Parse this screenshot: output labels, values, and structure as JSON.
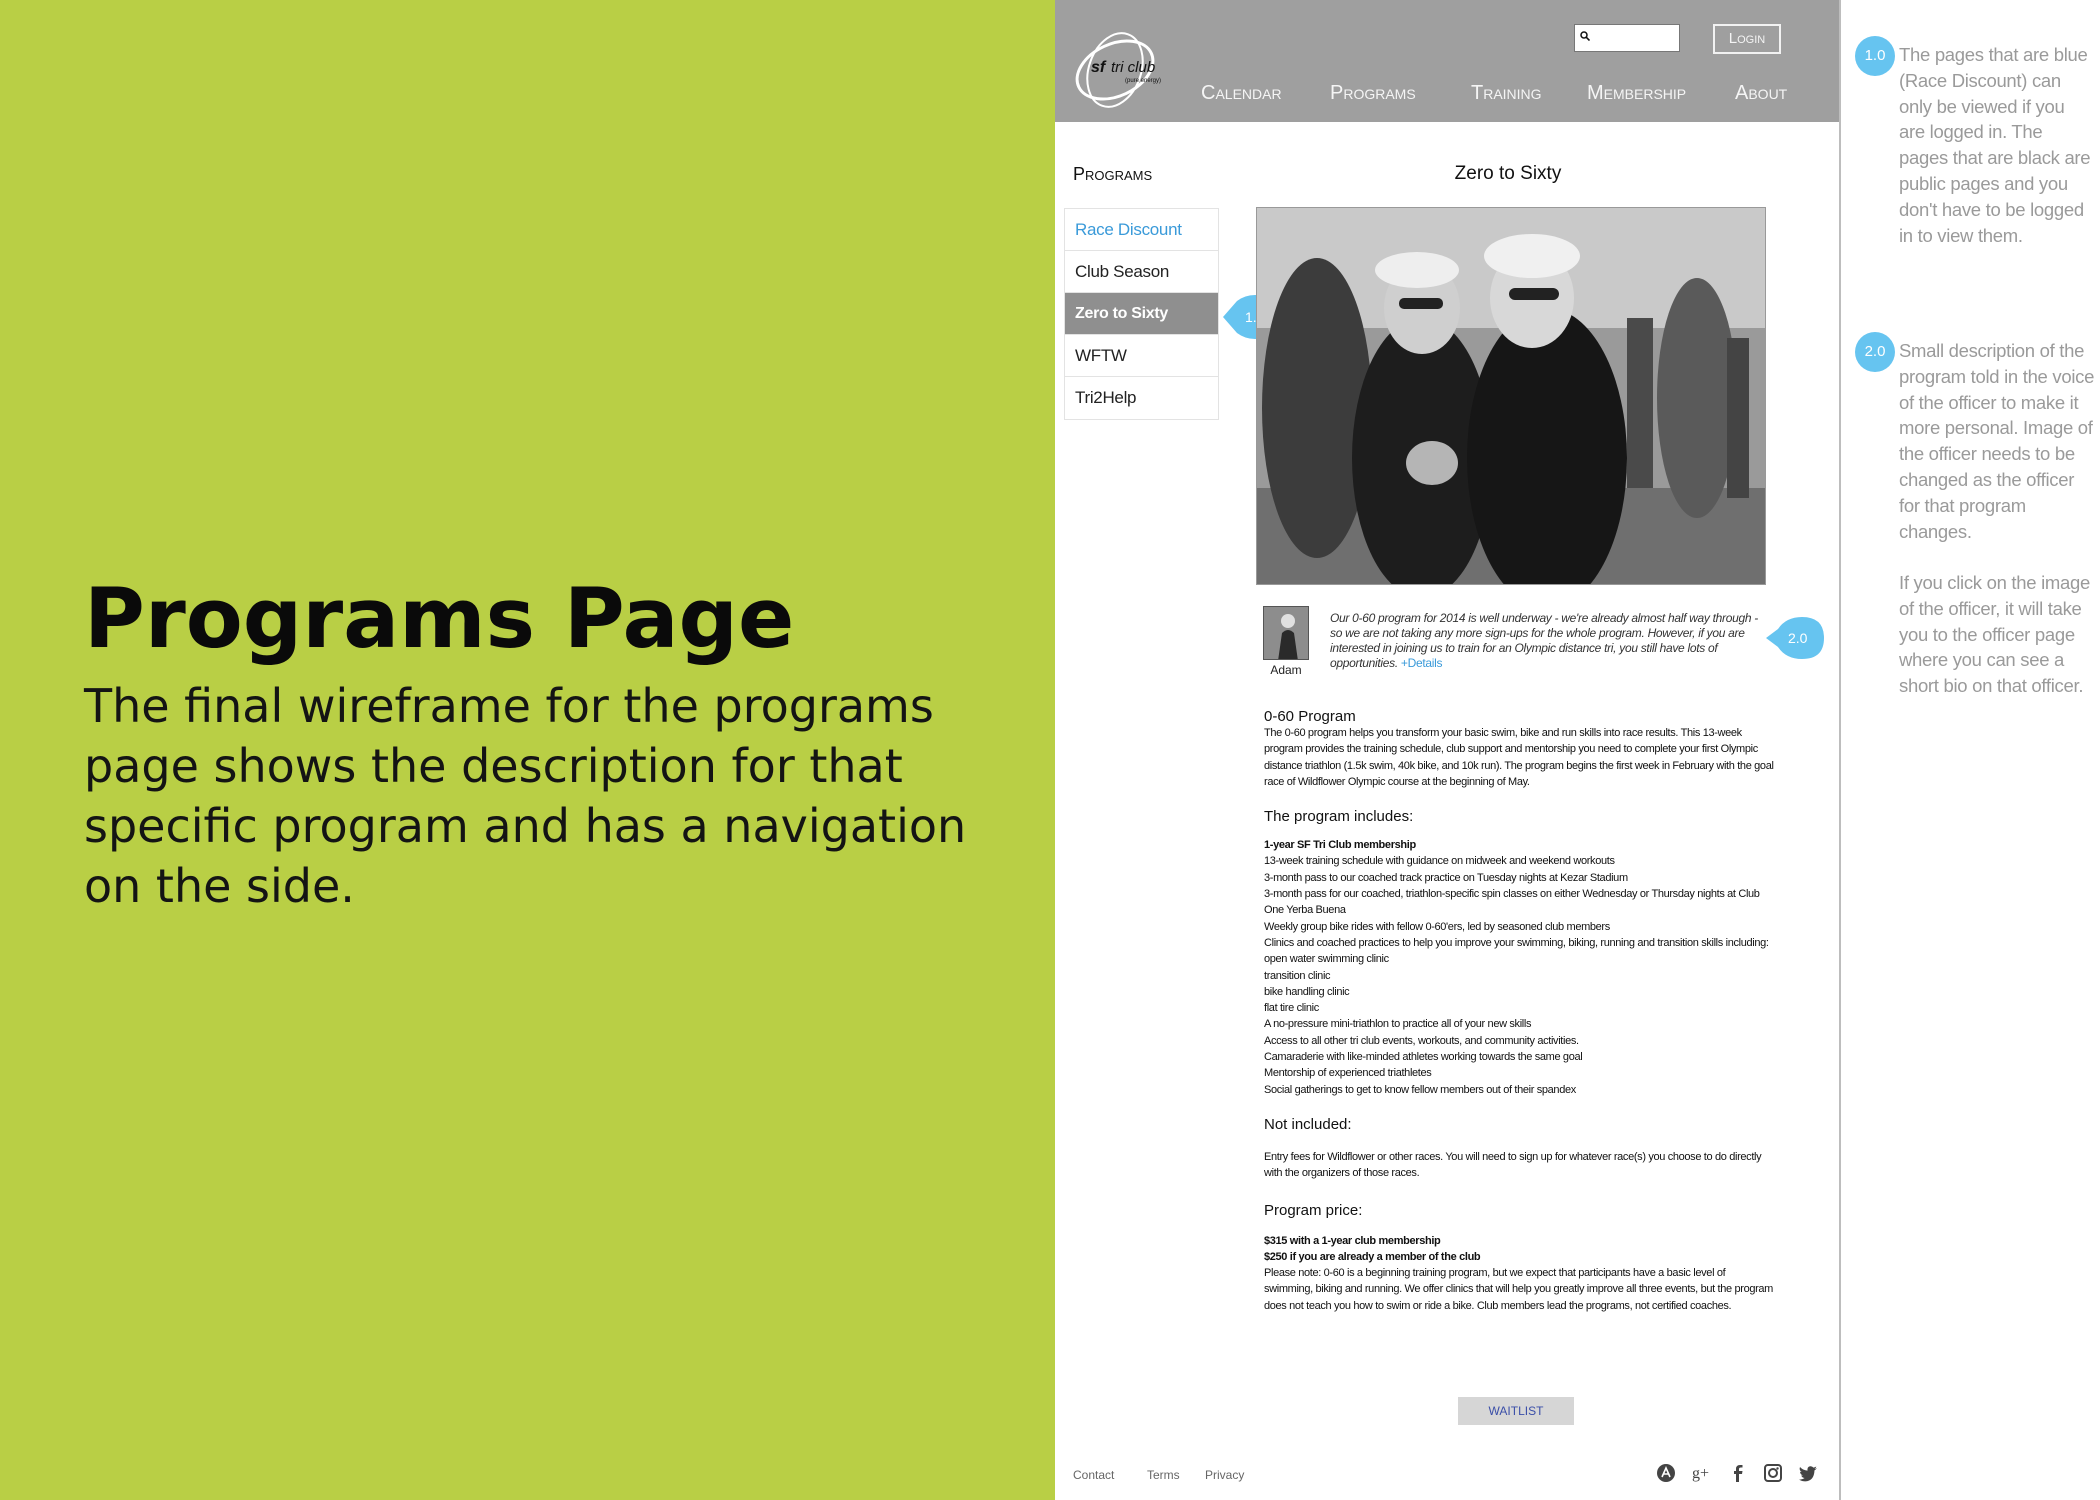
{
  "intro": {
    "title": "Programs Page",
    "description": "The final wireframe for the programs page shows the description for that specific program and has a navigation on the side."
  },
  "header": {
    "logo_text": "sf tri club",
    "logo_tagline": "(pure energy)",
    "login_label": "Login",
    "search_placeholder": "",
    "nav": [
      "Calendar",
      "Programs",
      "Training",
      "Membership",
      "About"
    ]
  },
  "sidebar": {
    "heading": "Programs",
    "items": [
      {
        "label": "Race Discount",
        "state": "members-only"
      },
      {
        "label": "Club Season",
        "state": "public"
      },
      {
        "label": "Zero to Sixty",
        "state": "active"
      },
      {
        "label": "WFTW",
        "state": "public"
      },
      {
        "label": "Tri2Help",
        "state": "public"
      }
    ]
  },
  "content": {
    "title": "Zero to Sixty",
    "officer": {
      "name": "Adam",
      "quote": "Our 0-60 program for 2014 is well underway - we're already almost half way through - so we are not taking any more sign-ups for the whole program.  However, if you are interested in joining us to train for an Olympic distance tri, you still have lots of opportunities.",
      "details_link": "+Details"
    },
    "program_heading": "0-60 Program",
    "program_text": "The 0-60 program helps you transform your basic swim, bike and run skills into race results. This 13-week program provides the training schedule, club support and mentorship you need to complete your first Olympic distance triathlon (1.5k swim, 40k bike, and 10k run). The program begins the first week in February with the goal race of Wildflower Olympic course at the beginning of May.",
    "includes_heading": "The program includes:",
    "includes_bold": "1-year SF Tri Club membership",
    "includes": [
      "13-week training schedule with guidance on midweek and weekend workouts",
      "3-month pass to our coached track practice on Tuesday nights at Kezar Stadium",
      "3-month pass for our coached, triathlon-specific spin classes on either Wednesday or Thursday nights at Club One Yerba Buena",
      "Weekly group bike rides with fellow 0-60'ers, led by seasoned club members",
      "Clinics and coached practices to help you improve your swimming, biking, running and transition skills including:",
      "open water swimming clinic",
      "transition clinic",
      "bike handling clinic",
      "flat tire clinic",
      "A no-pressure mini-triathlon to practice all of your new skills",
      "Access to all other tri club events, workouts, and community activities.",
      "Camaraderie with like-minded athletes working towards the same goal",
      "Mentorship of experienced triathletes",
      "Social gatherings to get to know fellow members out of their spandex"
    ],
    "not_included_heading": "Not included:",
    "not_included_text": "Entry fees for Wildflower or other races.  You will need to sign up for whatever race(s) you choose to do directly with the organizers of those races.",
    "price_heading": "Program price:",
    "price_1": "$315 with a 1-year club membership",
    "price_2": "$250 if you are already a member of the club",
    "price_note": "Please note: 0-60 is a beginning training program, but we expect that participants have a basic level of swimming, biking and running. We offer clinics that will help you greatly improve all three events, but the program does not teach you how to swim or ride a bike. Club members lead the programs, not certified coaches.",
    "waitlist_label": "WAITLIST"
  },
  "footer": {
    "links": [
      "Contact",
      "Terms",
      "Privacy"
    ],
    "social_icons": [
      "app-icon",
      "google-plus-icon",
      "facebook-icon",
      "instagram-icon",
      "twitter-icon"
    ]
  },
  "annotations": [
    {
      "badge": "1.0",
      "text": "The pages that are blue (Race Discount) can only be viewed if you are logged in. The pages that are black are public pages and you don't have to be logged in to view them."
    },
    {
      "badge": "2.0",
      "text": "Small description of the program told in the voice of the officer to make it more personal. Image of the officer needs to be changed as the officer for that program changes."
    },
    {
      "badge": "",
      "text": "If you click on the image of the officer, it will take you to the officer page where you can see a short bio on that officer."
    }
  ],
  "colors": {
    "left_panel": "#b9cf45",
    "header_gray": "#9f9f9f",
    "link_blue": "#3a9ad9",
    "badge_blue": "#66c4f0",
    "active_gray": "#8f8f8f"
  }
}
